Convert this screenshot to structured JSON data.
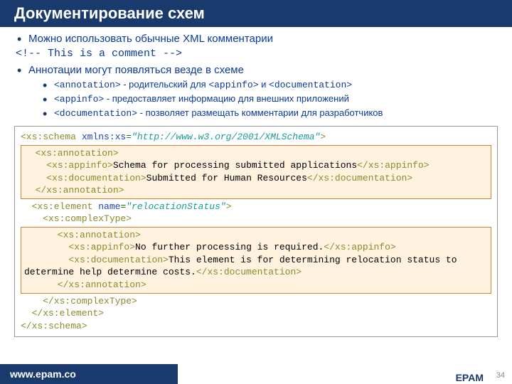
{
  "title": "Документирование схем",
  "bullets": {
    "b1": "Можно использовать обычные XML комментарии",
    "comment": "<!-- This is a comment -->",
    "b2": "Аннотации могут появляться везде в схеме",
    "sub": {
      "s1_pre": "<annotation>",
      "s1_txt": " - родительский для ",
      "s1_mid": "<appinfo>",
      "s1_and": " и ",
      "s1_end": "<documentation>",
      "s2_pre": "<appinfo>",
      "s2_txt": " - предоставляет информацию для внешних приложений",
      "s3_pre": "<documentation>",
      "s3_txt": " - позволяет размещать комментарии для разработчиков"
    }
  },
  "code": {
    "l1a": "<xs:schema",
    "l1b": " xmlns:xs",
    "l1c": "=",
    "l1d": "\"http://www.w3.org/2001/XMLSchema\"",
    "l1e": ">",
    "l2": "  <xs:annotation>",
    "l3a": "    <xs:appinfo>",
    "l3b": "Schema for processing submitted applications",
    "l3c": "</xs:appinfo>",
    "l4a": "    <xs:documentation>",
    "l4b": "Submitted for Human Resources",
    "l4c": "</xs:documentation>",
    "l5": "  </xs:annotation>",
    "l6a": "  <xs:element",
    "l6b": " name",
    "l6c": "=",
    "l6d": "\"relocationStatus\"",
    "l6e": ">",
    "l7": "    <xs:complexType>",
    "l8": "      <xs:annotation>",
    "l9a": "        <xs:appinfo>",
    "l9b": "No further processing is required.",
    "l9c": "</xs:appinfo>",
    "l10a": "        <xs:documentation>",
    "l10b": "This element is for determining relocation status to determine help determine costs.",
    "l10c": "</xs:documentation>",
    "l11": "      </xs:annotation>",
    "l12": "    </xs:complexType>",
    "l13": "  </xs:element>",
    "l14": "</xs:schema>"
  },
  "footer": {
    "url": "www.epam.co",
    "brand": "EPAM",
    "page": "34"
  }
}
